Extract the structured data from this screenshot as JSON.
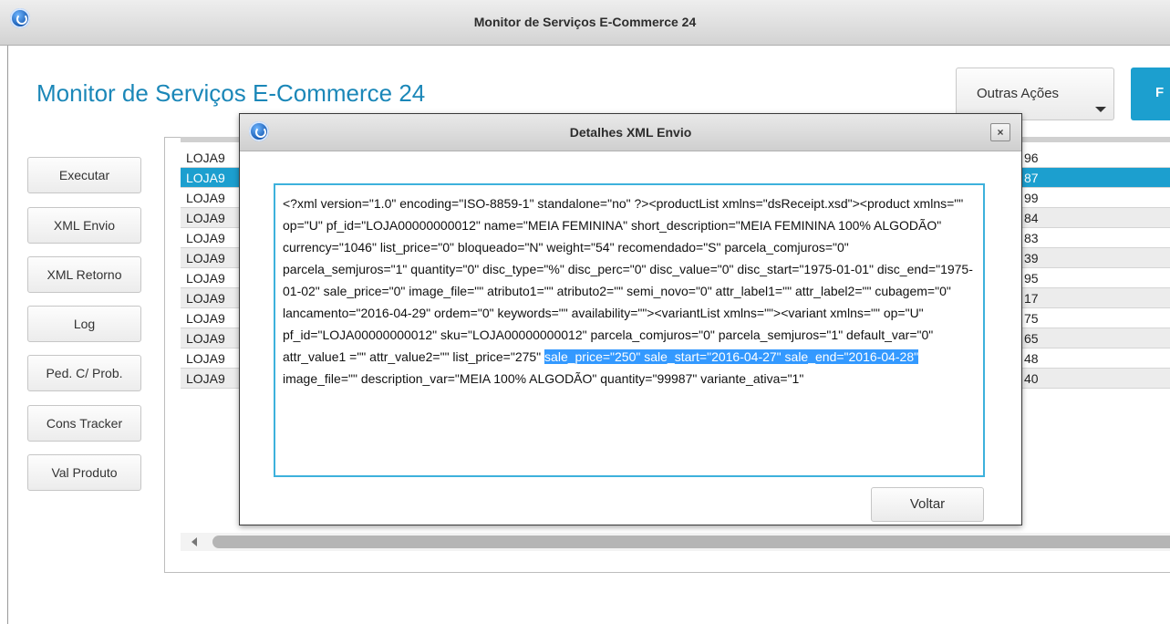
{
  "window": {
    "title": "Monitor de Serviços E-Commerce 24"
  },
  "header": {
    "page_title": "Monitor de Serviços E-Commerce 24",
    "other_actions_label": "Outras Ações",
    "primary_button_label": "F"
  },
  "sidebar": {
    "buttons": [
      "Executar",
      "XML Envio",
      "XML Retorno",
      "Log",
      "Ped. C/ Prob.",
      "Cons Tracker",
      "Val Produto"
    ]
  },
  "grid": {
    "rows": [
      {
        "c1": "LOJA9",
        "c2": "96"
      },
      {
        "c1": "LOJA9",
        "c2": "87",
        "selected": true
      },
      {
        "c1": "LOJA9",
        "c2": "99"
      },
      {
        "c1": "LOJA9",
        "c2": "84"
      },
      {
        "c1": "LOJA9",
        "c2": "83"
      },
      {
        "c1": "LOJA9",
        "c2": "39"
      },
      {
        "c1": "LOJA9",
        "c2": "95"
      },
      {
        "c1": "LOJA9",
        "c2": "17"
      },
      {
        "c1": "LOJA9",
        "c2": "75"
      },
      {
        "c1": "LOJA9",
        "c2": "65"
      },
      {
        "c1": "LOJA9",
        "c2": "48"
      },
      {
        "c1": "LOJA9",
        "c2": "40"
      }
    ]
  },
  "dialog": {
    "title": "Detalhes XML Envio",
    "close_label": "×",
    "xml_text_before": "<?xml version=\"1.0\" encoding=\"ISO-8859-1\" standalone=\"no\" ?><productList xmlns=\"dsReceipt.xsd\"><product xmlns=\"\" op=\"U\" pf_id=\"LOJA00000000012\" name=\"MEIA FEMININA\" short_description=\"MEIA FEMININA 100% ALGODÃO\" currency=\"1046\" list_price=\"0\" bloqueado=\"N\" weight=\"54\" recomendado=\"S\" parcela_comjuros=\"0\" parcela_semjuros=\"1\" quantity=\"0\" disc_type=\"%\" disc_perc=\"0\" disc_value=\"0\" disc_start=\"1975-01-01\" disc_end=\"1975-01-02\" sale_price=\"0\" image_file=\"\" atributo1=\"\" atributo2=\"\" semi_novo=\"0\" attr_label1=\"\" attr_label2=\"\" cubagem=\"0\" lancamento=\"2016-04-29\" ordem=\"0\" keywords=\"\" availability=\"\"><variantList xmlns=\"\"><variant xmlns=\"\" op=\"U\" pf_id=\"LOJA00000000012\" sku=\"LOJA00000000012\" parcela_comjuros=\"0\" parcela_semjuros=\"1\" default_var=\"0\" attr_value1 =\"\" attr_value2=\"\" list_price=\"275\" ",
    "xml_text_selected": "sale_price=\"250\" sale_start=\"2016-04-27\" sale_end=\"2016-04-28\"",
    "xml_text_after": " image_file=\"\" description_var=\"MEIA 100% ALGODÃO\" quantity=\"99987\" variante_ativa=\"1\"",
    "back_label": "Voltar"
  },
  "colors": {
    "accent": "#1c9fcf",
    "title_text": "#1b87b8",
    "selection": "#3399ff"
  }
}
